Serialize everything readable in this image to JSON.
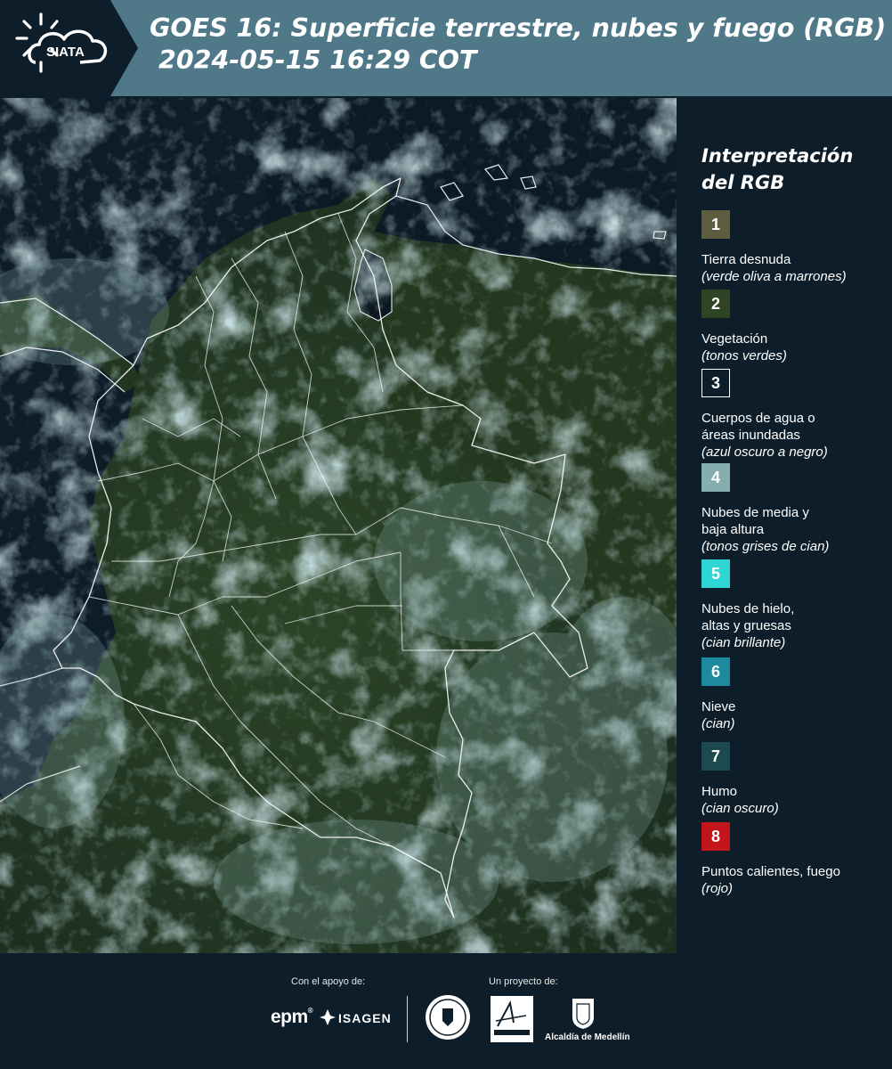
{
  "header": {
    "logo_text": "SIATA",
    "title_line1": "GOES 16: Superficie terrestre, nubes y fuego (RGB)",
    "title_line2": "2024-05-15 16:29 COT",
    "background_color": "#4f7888",
    "logo_panel_color": "#0d1e2a"
  },
  "map": {
    "region": "Colombia",
    "imagery": "satellite true-color RGB composite",
    "boundary_color": "#ffffff"
  },
  "legend": {
    "title": "Interpretación del RGB",
    "items": [
      {
        "number": "1",
        "label": "Tierra desnuda",
        "description": "(verde oliva a marrones)",
        "color": "#5b5c40"
      },
      {
        "number": "2",
        "label": "Vegetación",
        "description": "(tonos verdes)",
        "color": "#2e4424"
      },
      {
        "number": "3",
        "label": "Cuerpos de agua o\náreas inundadas",
        "description": "(azul oscuro a negro)",
        "color": "#0d1e2a"
      },
      {
        "number": "4",
        "label": "Nubes de media y\nbaja altura",
        "description": "(tonos grises de cian)",
        "color": "#86aeb0"
      },
      {
        "number": "5",
        "label": "Nubes de hielo,\naltas y gruesas",
        "description": "(cian brillante)",
        "color": "#2fd4d4"
      },
      {
        "number": "6",
        "label": "Nieve",
        "description": "(cian)",
        "color": "#1e8aa0"
      },
      {
        "number": "7",
        "label": "Humo",
        "description": "(cian oscuro)",
        "color": "#1d4a4e"
      },
      {
        "number": "8",
        "label": "Puntos calientes, fuego",
        "description": "(rojo)",
        "color": "#c3161c"
      }
    ]
  },
  "footer": {
    "support_label": "Con el apoyo de:",
    "project_label": "Un proyecto de:",
    "sponsors": [
      "epm",
      "ISAGEN"
    ],
    "partners": [
      "Área Metropolitana Valle de Aburrá",
      "Alcaldía de Medellín"
    ],
    "medellin_text": "Alcaldía de Medellín"
  }
}
